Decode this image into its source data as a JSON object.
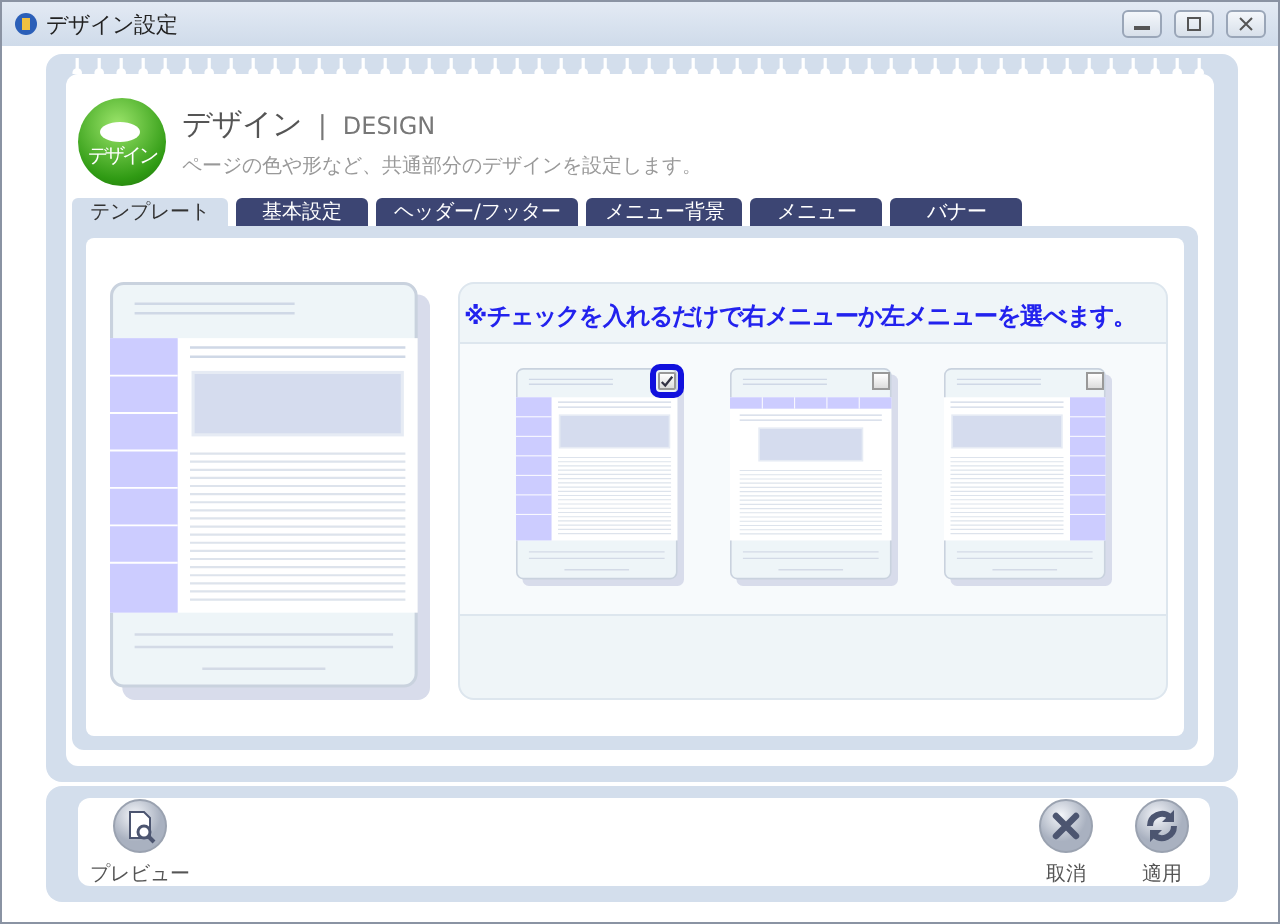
{
  "window": {
    "title": "デザイン設定"
  },
  "header": {
    "icon_label": "デザイン",
    "title": "デザイン",
    "separator": "|",
    "subtitle": "DESIGN",
    "description": "ページの色や形など、共通部分のデザインを設定します。"
  },
  "tabs": [
    {
      "label": "テンプレート",
      "selected": true
    },
    {
      "label": "基本設定",
      "selected": false
    },
    {
      "label": "ヘッダー/フッター",
      "selected": false
    },
    {
      "label": "メニュー背景",
      "selected": false
    },
    {
      "label": "メニュー",
      "selected": false
    },
    {
      "label": "バナー",
      "selected": false
    }
  ],
  "notice": "※チェックを入れるだけで右メニューか左メニューを選べます。",
  "layouts": [
    {
      "kind": "left",
      "checked": true,
      "selected": true
    },
    {
      "kind": "top",
      "checked": false,
      "selected": false
    },
    {
      "kind": "right",
      "checked": false,
      "selected": false
    }
  ],
  "footer_buttons": [
    {
      "kind": "preview",
      "label": "プレビュー"
    },
    {
      "kind": "cancel",
      "label": "取消"
    },
    {
      "kind": "apply",
      "label": "適用"
    }
  ]
}
